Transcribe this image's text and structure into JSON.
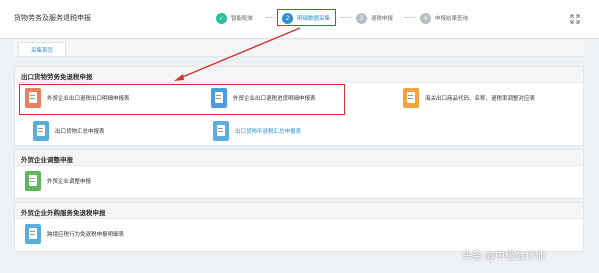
{
  "app": {
    "title": "货物劳务及服务退税申报"
  },
  "steps": [
    {
      "num": "✓",
      "label": "智能配单",
      "state": "done"
    },
    {
      "num": "2",
      "label": "明细数据采集",
      "state": "active"
    },
    {
      "num": "3",
      "label": "退税申报",
      "state": "todo"
    },
    {
      "num": "4",
      "label": "申报结果查询",
      "state": "todo"
    }
  ],
  "tab": {
    "label": "采集首页"
  },
  "sections": [
    {
      "title": "出口货物劳务免退税申报",
      "items": [
        {
          "label": "外贸企业出口退税出口明细申报表",
          "icon": "document-icon",
          "color": "#ef7e5a"
        },
        {
          "label": "外贸企业出口退税进货明细申报表",
          "icon": "document-import-icon",
          "color": "#4a9de0"
        },
        {
          "label": "海关出口商品代码、名称、退税率调整对应表",
          "icon": "table-icon",
          "color": "#f2a33a"
        },
        {
          "label": "出口货物汇总申报表",
          "icon": "summary-icon",
          "color": "#5aaedc"
        },
        {
          "label": "出口货物不退税汇总申报表",
          "icon": "no-refund-icon",
          "color": "#5aaedc"
        }
      ]
    },
    {
      "title": "外贸企业调整申报",
      "items": [
        {
          "label": "外贸企业调整申报",
          "icon": "adjust-icon",
          "color": "#5fb85c"
        }
      ]
    },
    {
      "title": "外贸企业外购服务免退税申报",
      "items": [
        {
          "label": "跨境应税行为免退税申报明细表",
          "icon": "cross-border-icon",
          "color": "#5aaedc"
        }
      ]
    }
  ],
  "watermark": {
    "text": "头条 @中级会计师"
  },
  "colors": {
    "accent": "#2d8fd5",
    "highlight": "#d9302c",
    "done": "#2fbf9f"
  }
}
